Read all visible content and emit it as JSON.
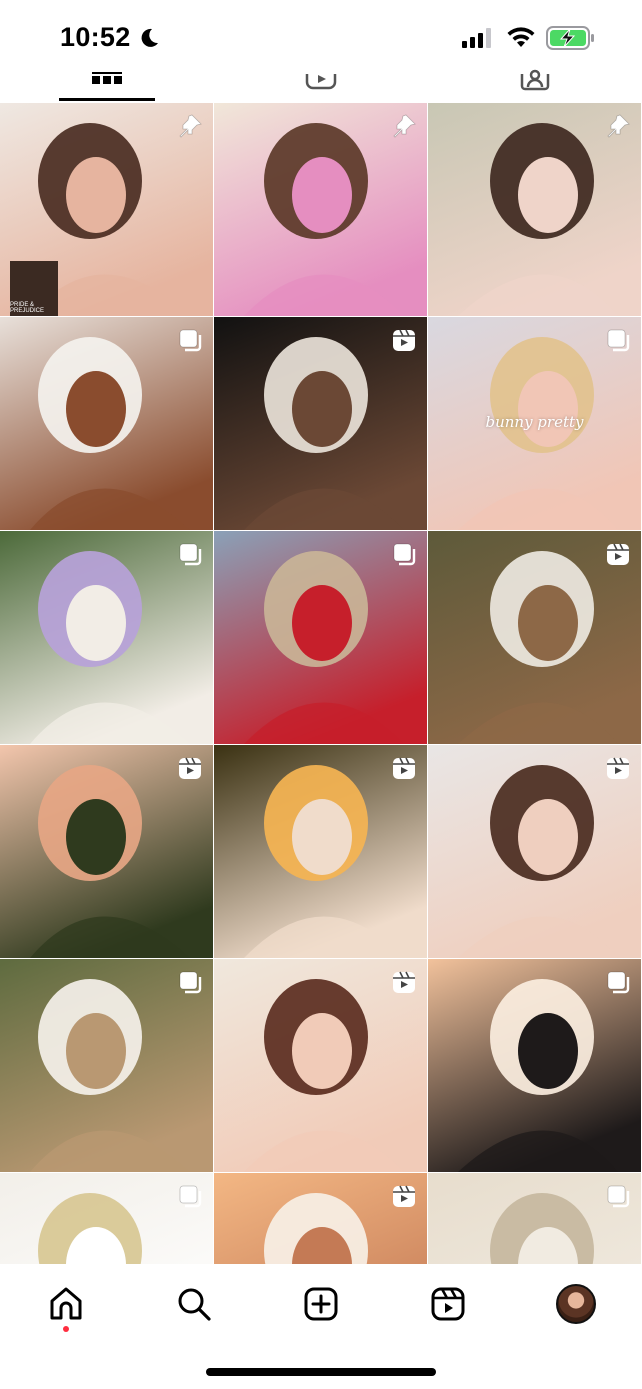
{
  "status_bar": {
    "time": "10:52"
  },
  "tabs": [
    {
      "name": "posts-grid",
      "icon": "grid-icon",
      "active": true
    },
    {
      "name": "reels",
      "icon": "reels-icon",
      "active": false
    },
    {
      "name": "tagged",
      "icon": "tagged-person-icon",
      "active": false
    }
  ],
  "grid_overlay": {
    "caption_sticker": "PRIDE & PREJUDICE",
    "handwritten_text": "bunny pretty"
  },
  "tiles": [
    {
      "name": "tile-curly-updo-portrait",
      "badge": "pin-icon",
      "colors": [
        "#efe8e2",
        "#4a2d22",
        "#e6b49f"
      ]
    },
    {
      "name": "tile-braid-profile-pink-sweater",
      "badge": "pin-icon",
      "colors": [
        "#f1e7d9",
        "#5b3828",
        "#e58ec0"
      ]
    },
    {
      "name": "tile-floral-lace-bride",
      "badge": "pin-icon",
      "colors": [
        "#c8c7b4",
        "#3e2820",
        "#efd4c9"
      ]
    },
    {
      "name": "tile-wedding-dress-room",
      "badge": "carousel-icon",
      "colors": [
        "#e8e0da",
        "#f4f2ee",
        "#8a4c2e"
      ]
    },
    {
      "name": "tile-night-kiss-couple",
      "badge": "reel-icon",
      "colors": [
        "#111111",
        "#e9e2d8",
        "#6b4835"
      ]
    },
    {
      "name": "tile-blonde-bangs-collage",
      "badge": "carousel-icon",
      "colors": [
        "#d9d8e0",
        "#e2c28e",
        "#f1c6b6"
      ]
    },
    {
      "name": "tile-bride-hydrangeas",
      "badge": "carousel-icon",
      "colors": [
        "#4c6a3a",
        "#b7a2d9",
        "#f2ede6"
      ]
    },
    {
      "name": "tile-paris-street-red-top",
      "badge": "carousel-icon",
      "colors": [
        "#8aa1b8",
        "#c9b497",
        "#c61f2b"
      ]
    },
    {
      "name": "tile-short-hair-cardigan",
      "badge": "reel-icon",
      "colors": [
        "#5d5a3a",
        "#ede8e0",
        "#8d6847"
      ]
    },
    {
      "name": "tile-bridesmaids-balcony",
      "badge": "reel-icon",
      "colors": [
        "#f3c6ad",
        "#e6a684",
        "#2f3a1e"
      ]
    },
    {
      "name": "tile-bride-golden-hour-field",
      "badge": "reel-icon",
      "colors": [
        "#3a3112",
        "#f5b452",
        "#f0dccb"
      ]
    },
    {
      "name": "tile-messy-bun-makeup",
      "badge": "reel-icon",
      "colors": [
        "#e9e6e5",
        "#4a2b20",
        "#efcfbf"
      ]
    },
    {
      "name": "tile-bridal-party-gown",
      "badge": "carousel-icon",
      "colors": [
        "#5e6b3f",
        "#f5f1ea",
        "#b99872"
      ]
    },
    {
      "name": "tile-veil-lipstick-portrait",
      "badge": "reel-icon",
      "colors": [
        "#f0e8dd",
        "#5b2d20",
        "#f1cbb8"
      ]
    },
    {
      "name": "tile-couple-terrace-sunset",
      "badge": "carousel-icon",
      "colors": [
        "#f2c29c",
        "#fbeee0",
        "#1e1a1a"
      ]
    },
    {
      "name": "tile-satin-heels",
      "badge": "carousel-icon",
      "colors": [
        "#f2efe9",
        "#d7c793",
        "#ffffff"
      ]
    },
    {
      "name": "tile-veil-kiss-closeup",
      "badge": "reel-icon",
      "colors": [
        "#f3b784",
        "#f7f0e6",
        "#c47a55"
      ]
    },
    {
      "name": "tile-ornate-building",
      "badge": "carousel-icon",
      "colors": [
        "#e7ddcd",
        "#c6b79e",
        "#f1ebe1"
      ]
    }
  ],
  "bottom_nav": [
    {
      "name": "nav-home",
      "icon": "home-icon"
    },
    {
      "name": "nav-search",
      "icon": "search-icon"
    },
    {
      "name": "nav-create",
      "icon": "plus-square-icon"
    },
    {
      "name": "nav-reels",
      "icon": "reels-icon"
    },
    {
      "name": "nav-profile",
      "icon": "profile-avatar-icon"
    }
  ],
  "colors": {
    "accent_dot": "#ff2d3f",
    "battery_green": "#4cd964",
    "text": "#000000"
  }
}
